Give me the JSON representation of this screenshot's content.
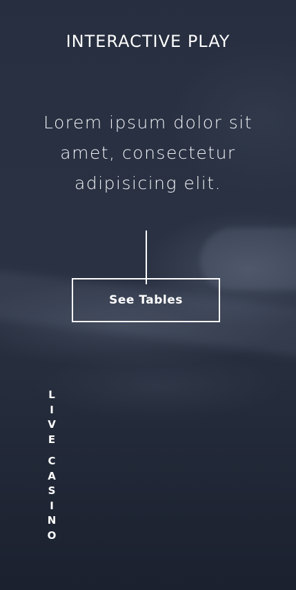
{
  "hero": {
    "eyebrow": "INTERACTIVE PLAY",
    "headline": "Lorem ipsum dolor sit amet, consectetur adipisicing elit.",
    "cta_label": "See Tables",
    "vertical_label": {
      "word1": [
        "L",
        "I",
        "V",
        "E"
      ],
      "word2": [
        "C",
        "A",
        "S",
        "I",
        "N",
        "O"
      ]
    }
  },
  "colors": {
    "background": "#2a3244",
    "text": "#ffffff"
  }
}
